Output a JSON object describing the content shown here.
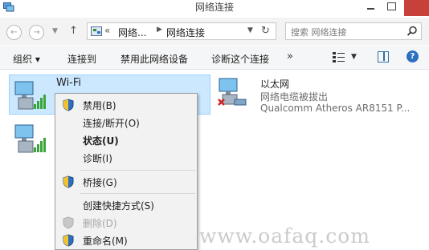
{
  "window": {
    "title": "网络连接"
  },
  "address": {
    "prefix": "«",
    "crumbs": [
      "网络...",
      "网络连接"
    ],
    "search_placeholder": "搜索 网络连接"
  },
  "toolbar": {
    "organize": "组织 ▾",
    "connect_to": "连接到",
    "disable": "禁用此网络设备",
    "diagnose": "诊断这个连接",
    "more": "»"
  },
  "adapters": {
    "wifi": {
      "name": "Wi-Fi",
      "sub": ""
    },
    "ethernet": {
      "name": "以太网",
      "status": "网络电缆被拔出",
      "device": "Qualcomm Atheros AR8151 P..."
    }
  },
  "context_menu": {
    "items": [
      {
        "label": "禁用(B)",
        "shield": true
      },
      {
        "label": "连接/断开(O)"
      },
      {
        "label": "状态(U)",
        "bold": true
      },
      {
        "label": "诊断(I)"
      },
      {
        "label": "桥接(G)",
        "shield": true
      },
      {
        "label": "创建快捷方式(S)"
      },
      {
        "label": "删除(D)",
        "shield": true,
        "disabled": true
      },
      {
        "label": "重命名(M)",
        "shield": true
      }
    ]
  },
  "watermark": "www.oafaq.com",
  "colors": {
    "selection": "#cce8ff",
    "close": "#c7403a",
    "signal": "#3aa53a"
  }
}
